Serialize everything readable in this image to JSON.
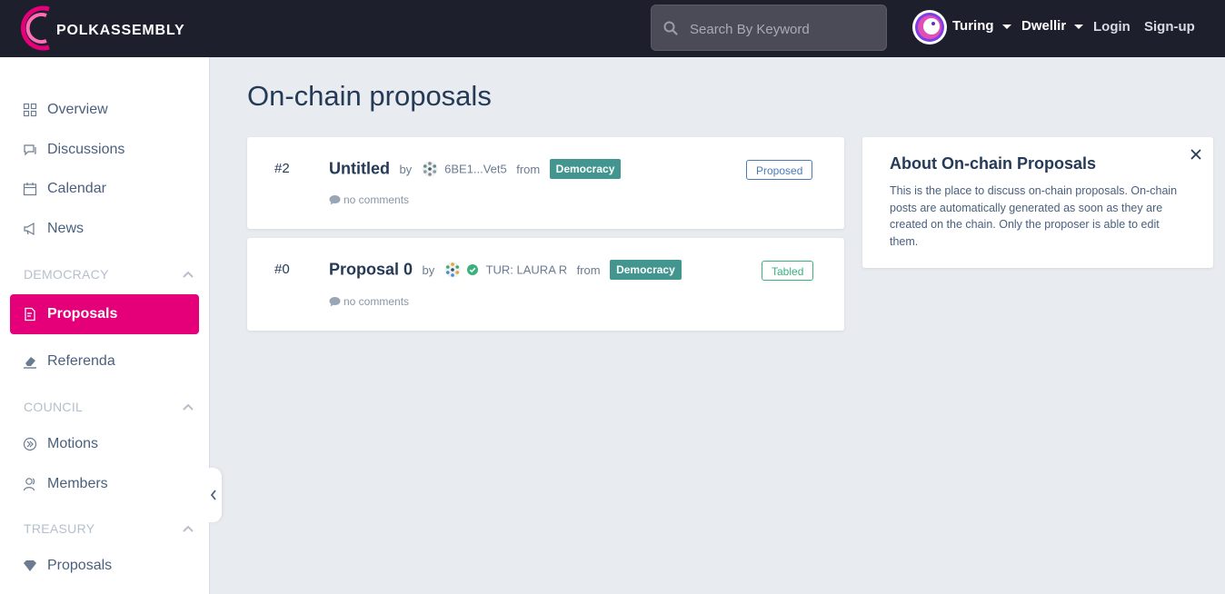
{
  "brand": {
    "name": "POLKASSEMBLY"
  },
  "topbar": {
    "search_placeholder": "Search By Keyword",
    "network": "Turing",
    "rpc": "Dwellir",
    "login": "Login",
    "signup": "Sign-up"
  },
  "sidebar": {
    "items": [
      {
        "label": "Overview",
        "icon": "grid-icon"
      },
      {
        "label": "Discussions",
        "icon": "chat-icon"
      },
      {
        "label": "Calendar",
        "icon": "calendar-icon"
      },
      {
        "label": "News",
        "icon": "megaphone-icon"
      }
    ],
    "democracy": {
      "title": "DEMOCRACY",
      "items": [
        {
          "label": "Proposals",
          "icon": "proposal-icon",
          "active": true
        },
        {
          "label": "Referenda",
          "icon": "eraser-icon"
        }
      ]
    },
    "council": {
      "title": "COUNCIL",
      "items": [
        {
          "label": "Motions",
          "icon": "motion-icon"
        },
        {
          "label": "Members",
          "icon": "members-icon"
        }
      ]
    },
    "treasury": {
      "title": "TREASURY",
      "items": [
        {
          "label": "Proposals",
          "icon": "diamond-icon"
        }
      ]
    }
  },
  "main": {
    "title": "On-chain proposals",
    "proposals": [
      {
        "number": "#2",
        "title": "Untitled",
        "by": "by",
        "author": "6BE1...Vet5",
        "from": "from",
        "topic": "Democracy",
        "comments": "no comments",
        "status": "Proposed"
      },
      {
        "number": "#0",
        "title": "Proposal 0",
        "by": "by",
        "author": "TUR: LAURA R",
        "from": "from",
        "topic": "Democracy",
        "comments": "no comments",
        "status": "Tabled"
      }
    ]
  },
  "about": {
    "title": "About On-chain Proposals",
    "body": "This is the place to discuss on-chain proposals. On-chain posts are automatically generated as soon as they are created on the chain. Only the proposer is able to edit them."
  },
  "colors": {
    "topbar": "#1d1f2d",
    "accent": "#e5007a",
    "topic_tag": "#43968f",
    "status_proposed": "#4a7ab8",
    "status_tabled": "#3ab07d"
  }
}
